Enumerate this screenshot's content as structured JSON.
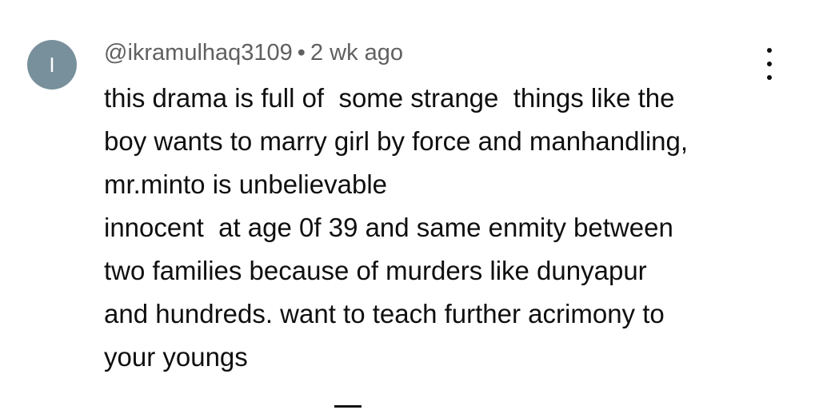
{
  "comment": {
    "avatar_letter": "I",
    "avatar_color": "#78909c",
    "username": "@ikramulhaq3109",
    "separator": "•",
    "timestamp": "2 wk ago",
    "more_icon": "more-vertical-icon",
    "lines": [
      "this drama is full of  some strange  things like the",
      "boy wants to marry girl by force and manhandling,",
      "mr.minto is unbelievable",
      "innocent  at age 0f 39 and same enmity between",
      "two families because of murders like dunyapur",
      "and hundreds. want to teach further acrimony to",
      "your youngs"
    ]
  }
}
